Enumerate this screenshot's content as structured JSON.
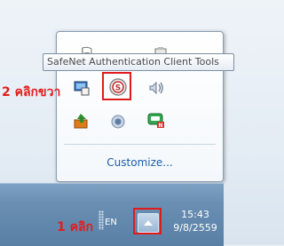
{
  "tooltip": {
    "text": "SafeNet Authentication Client Tools"
  },
  "flyout": {
    "customize_label": "Customize...",
    "icons": [
      {
        "name": "flag-icon"
      },
      {
        "name": "safenet-icon"
      },
      {
        "name": "speaker-icon"
      },
      {
        "name": "network-icon"
      },
      {
        "name": "bluetooth-icon"
      },
      {
        "name": "updater-icon"
      },
      {
        "name": "chat-icon"
      },
      {
        "name": "safenet-tray-icon"
      }
    ]
  },
  "annotations": {
    "step2_label": "2 คลิกขวา",
    "step1_label": "1 คลิก",
    "highlight_color": "#e11b1b"
  },
  "taskbar": {
    "language": "EN",
    "clock_time": "15:43",
    "clock_date": "9/8/2559",
    "show_hidden_icon": "triangle-up-icon"
  }
}
